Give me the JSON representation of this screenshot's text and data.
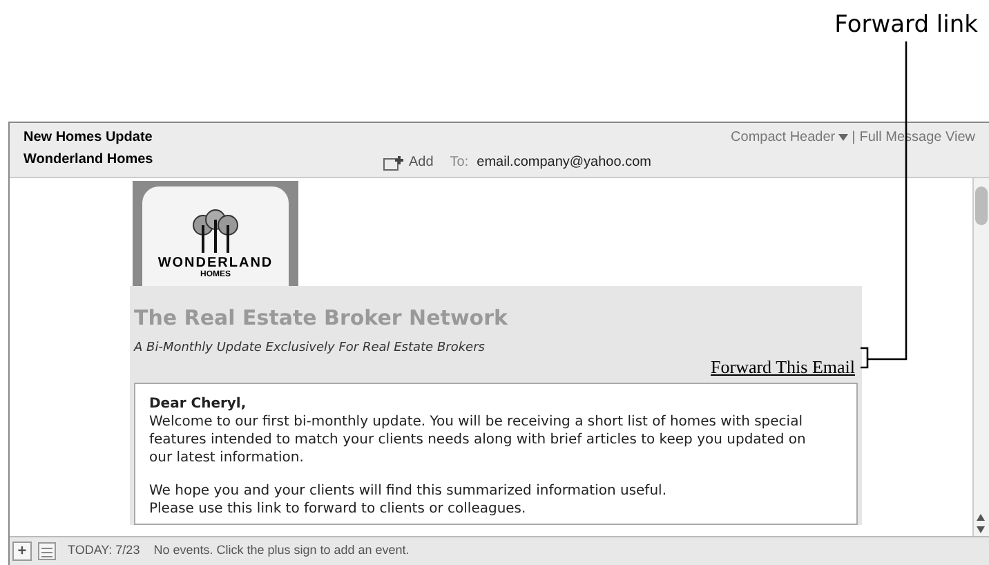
{
  "callout": {
    "label": "Forward link"
  },
  "header": {
    "subject": "New Homes Update",
    "sender": "Wonderland Homes",
    "add_label": "Add",
    "to_label": "To:",
    "to_address": "email.company@yahoo.com",
    "view_menu": "Compact Header",
    "separator": "|",
    "full_view": "Full Message View"
  },
  "email": {
    "logo_text": "WONDERLAND",
    "logo_subtext": "HOMES",
    "title": "The Real Estate Broker Network",
    "subtitle": "A Bi-Monthly Update Exclusively For Real Estate Brokers",
    "forward_link": "Forward This Email",
    "greeting": "Dear Cheryl,",
    "paragraphs": [
      "Welcome to our first bi-monthly update. You will be receiving a short list of homes with special features intended to match your clients needs along with brief articles to keep you updated on our latest information.",
      "We hope you and your clients will find this summarized information useful.",
      "Please use this link to forward to clients or colleagues."
    ]
  },
  "status_bar": {
    "add_button": "+",
    "today": "TODAY: 7/23",
    "message": "No events. Click the plus sign to add an event."
  }
}
